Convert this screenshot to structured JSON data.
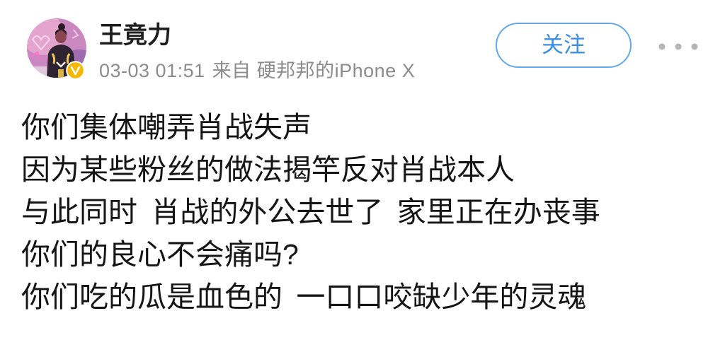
{
  "post": {
    "author": {
      "name": "王竟力",
      "avatar": "user-avatar-image",
      "verified": true,
      "verified_icon": "verified-badge-icon"
    },
    "timestamp": "03-03 01:51",
    "source": "来自 硬邦邦的iPhone X",
    "follow_button": {
      "label": "关注"
    },
    "more_icon": "more-dots-icon",
    "body_lines": [
      "你们集体嘲弄肖战失声",
      "因为某些粉丝的做法揭竿反对肖战本人",
      "与此同时 肖战的外公去世了 家里正在办丧事",
      "你们的良心不会痛吗?",
      "你们吃的瓜是血色的 一口口咬缺少年的灵魂"
    ]
  },
  "colors": {
    "accent": "#3a8ee6",
    "accent_border": "#62a8ea",
    "badge": "#f6b800",
    "name_text": "#1e1e1e",
    "meta_text": "#8c8c8c",
    "body_text": "#151515",
    "icon_gray": "#b5b5b5",
    "background": "#ffffff"
  }
}
